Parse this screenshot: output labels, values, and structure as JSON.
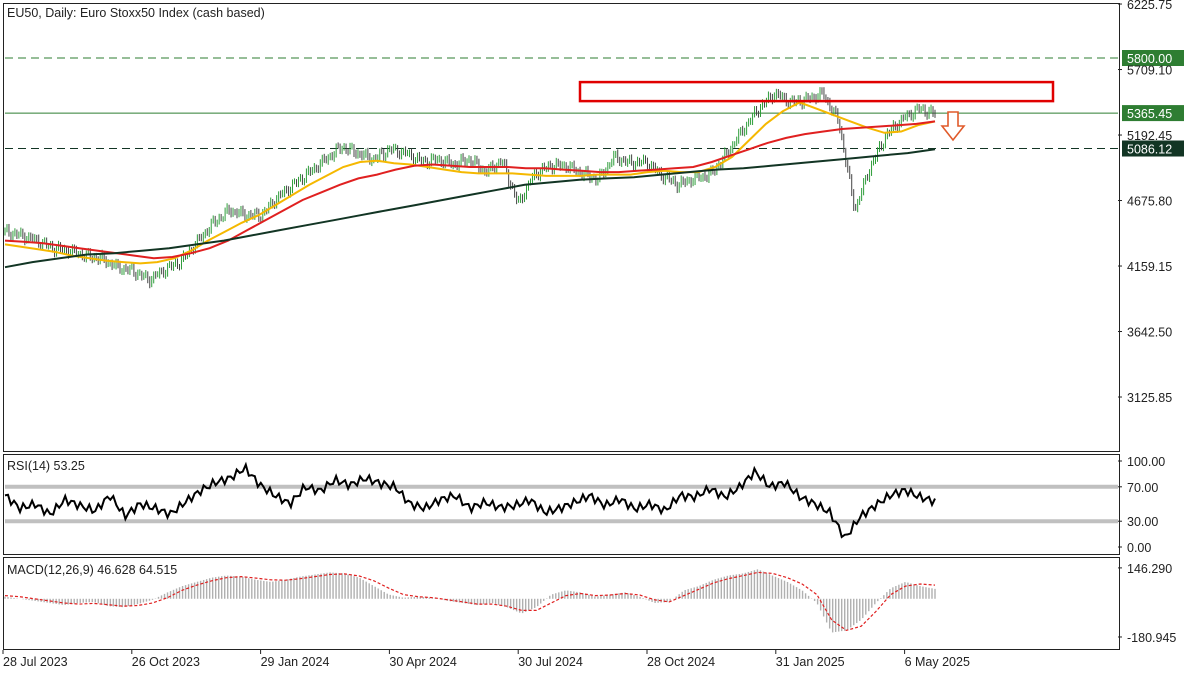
{
  "chart_data": [
    {
      "type": "line",
      "title": "EU50, Daily:  Euro Stoxx50 Index (cash based)",
      "yticks": [
        6225.75,
        5709.1,
        5192.45,
        4675.8,
        4159.15,
        3642.5,
        3125.85
      ],
      "ylim": [
        2700,
        6226
      ],
      "levels": [
        {
          "value": 5800.0,
          "label": "5800.00",
          "style": "dashed",
          "color": "#2e7d32"
        },
        {
          "value": 5365.45,
          "label": "5365.45",
          "style": "solid",
          "color": "#2e7d32"
        },
        {
          "value": 5086.12,
          "label": "5086.12",
          "style": "dashed",
          "color": "#123524"
        }
      ],
      "resistance_zone": {
        "top": 5610,
        "bottom": 5460,
        "color": "#e00000"
      },
      "arrow": {
        "direction": "down",
        "color": "#e05a2a"
      },
      "x_labels": [
        "28 Jul 2023",
        "26 Oct 2023",
        "29 Jan 2024",
        "30 Apr 2024",
        "30 Jul 2024",
        "28 Oct 2024",
        "31 Jan 2025",
        "6 May 2025"
      ],
      "price_series": [
        4430,
        4400,
        4360,
        4300,
        4280,
        4240,
        4220,
        4150,
        4120,
        4050,
        4130,
        4200,
        4350,
        4500,
        4600,
        4560,
        4560,
        4700,
        4800,
        4900,
        5000,
        5100,
        5050,
        5000,
        5080,
        5050,
        4980,
        5000,
        4960,
        5000,
        4900,
        4990,
        4650,
        4880,
        4950,
        4950,
        4890,
        4840,
        5020,
        4970,
        4980,
        4870,
        4800,
        4850,
        4880,
        5040,
        5230,
        5400,
        5520,
        5450,
        5470,
        5520,
        5300,
        4600,
        4950,
        5200,
        5320,
        5400,
        5360
      ],
      "series": [
        {
          "values": [
            4330,
            4310,
            4290,
            4270,
            4240,
            4220,
            4200,
            4190,
            4180,
            4190,
            4220,
            4280,
            4360,
            4430,
            4500,
            4560,
            4640,
            4720,
            4800,
            4870,
            4940,
            4980,
            4990,
            4970,
            4960,
            4940,
            4920,
            4900,
            4890,
            4890,
            4890,
            4880,
            4870,
            4870,
            4870,
            4880,
            4880,
            4880,
            4900,
            4910,
            4900,
            4900,
            4940,
            5020,
            5150,
            5280,
            5380,
            5450,
            5400,
            5350,
            5300,
            5250,
            5210,
            5220,
            5270,
            5300
          ],
          "color": "#f5b800",
          "width": 2
        },
        {
          "values": [
            4360,
            4350,
            4340,
            4320,
            4300,
            4280,
            4260,
            4240,
            4220,
            4230,
            4260,
            4300,
            4360,
            4440,
            4520,
            4600,
            4680,
            4740,
            4800,
            4850,
            4880,
            4920,
            4950,
            4960,
            4950,
            4940,
            4940,
            4940,
            4930,
            4930,
            4920,
            4910,
            4900,
            4900,
            4910,
            4920,
            4930,
            4940,
            4980,
            5030,
            5080,
            5130,
            5170,
            5200,
            5220,
            5240,
            5250,
            5260,
            5270,
            5280,
            5300
          ],
          "color": "#e02020",
          "width": 2
        },
        {
          "values": [
            4150,
            4190,
            4220,
            4250,
            4260,
            4280,
            4300,
            4330,
            4360,
            4400,
            4440,
            4480,
            4520,
            4560,
            4600,
            4640,
            4680,
            4720,
            4760,
            4800,
            4820,
            4840,
            4850,
            4860,
            4880,
            4900,
            4920,
            4930,
            4950,
            4970,
            4990,
            5010,
            5030,
            5050,
            5080
          ],
          "color": "#123524",
          "width": 2
        }
      ]
    },
    {
      "type": "line",
      "title": "RSI(14) 53.25",
      "yticks": [
        100.0,
        70.0,
        30.0,
        0.0
      ],
      "ylim": [
        -10,
        100
      ],
      "levels": [
        70,
        30
      ],
      "values": [
        60,
        45,
        50,
        38,
        55,
        48,
        42,
        60,
        36,
        50,
        45,
        38,
        52,
        65,
        75,
        80,
        92,
        72,
        60,
        50,
        70,
        65,
        78,
        72,
        80,
        74,
        70,
        50,
        45,
        55,
        60,
        45,
        52,
        46,
        48,
        55,
        40,
        45,
        52,
        60,
        48,
        56,
        44,
        50,
        42,
        60,
        58,
        68,
        58,
        70,
        88,
        70,
        75,
        58,
        50,
        40,
        10,
        35,
        48,
        60,
        66,
        58,
        53
      ],
      "color": "#000000"
    },
    {
      "type": "bar",
      "title": "MACD(12,26,9) 46.628 64.515",
      "yticks": [
        146.29,
        -180.945
      ],
      "ylim": [
        -200,
        160
      ],
      "histogram": [
        10,
        0,
        -10,
        -20,
        -30,
        -20,
        -15,
        -35,
        -40,
        -25,
        -5,
        30,
        60,
        80,
        100,
        110,
        105,
        90,
        80,
        90,
        105,
        115,
        125,
        120,
        100,
        60,
        20,
        5,
        10,
        5,
        -10,
        -20,
        -30,
        -20,
        -40,
        -70,
        -40,
        20,
        40,
        30,
        10,
        20,
        30,
        10,
        -20,
        -15,
        40,
        60,
        90,
        110,
        120,
        140,
        110,
        80,
        40,
        -20,
        -160,
        -150,
        -100,
        -20,
        50,
        80,
        60,
        47
      ],
      "signal": [
        15,
        10,
        0,
        -10,
        -20,
        -25,
        -22,
        -28,
        -35,
        -32,
        -20,
        5,
        40,
        65,
        85,
        100,
        105,
        98,
        90,
        88,
        95,
        105,
        115,
        118,
        108,
        85,
        50,
        20,
        10,
        5,
        -5,
        -15,
        -25,
        -25,
        -35,
        -55,
        -55,
        -20,
        15,
        25,
        15,
        18,
        25,
        18,
        -5,
        -15,
        15,
        45,
        75,
        95,
        110,
        125,
        120,
        100,
        70,
        20,
        -100,
        -150,
        -130,
        -60,
        20,
        60,
        70,
        65
      ],
      "bar_color": "#b0b0b0",
      "signal_color": "#e02020"
    }
  ]
}
